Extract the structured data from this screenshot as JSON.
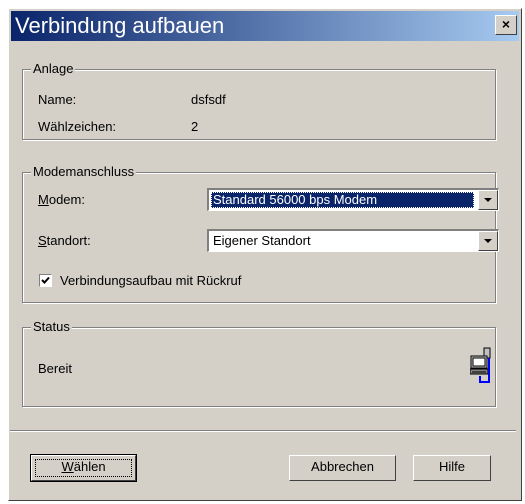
{
  "window": {
    "title": "Verbindung aufbauen",
    "close_label": "×"
  },
  "anlage": {
    "legend": "Anlage",
    "name_label": "Name:",
    "name_value": "dsfsdf",
    "dial_label": "Wählzeichen:",
    "dial_value": "2"
  },
  "modem": {
    "legend": "Modemanschluss",
    "modem_label_ul": "M",
    "modem_label_rest": "odem:",
    "modem_value": "Standard 56000 bps Modem",
    "location_label_ul": "S",
    "location_label_rest": "tandort:",
    "location_value": "Eigener Standort",
    "callback_label": "Verbindungsaufbau mit Rückruf",
    "callback_checked": true
  },
  "status": {
    "legend": "Status",
    "text": "Bereit",
    "icon": "network-computer-icon"
  },
  "buttons": {
    "dial_ul": "W",
    "dial_rest": "ählen",
    "cancel": "Abbrechen",
    "help": "Hilfe"
  }
}
